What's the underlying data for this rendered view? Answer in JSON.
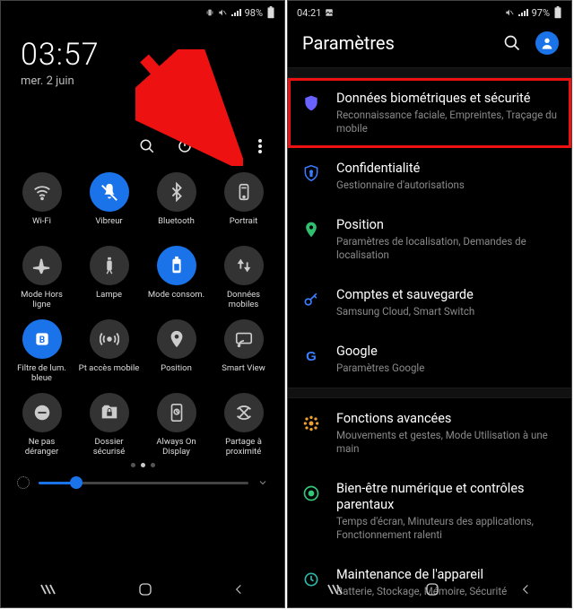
{
  "left": {
    "status": {
      "battery_text": "98%"
    },
    "clock": "03:57",
    "date": "mer. 2 juin",
    "qs": [
      {
        "name": "wifi",
        "label": "Wi-Fi",
        "on": false
      },
      {
        "name": "vibreur",
        "label": "Vibreur",
        "on": true
      },
      {
        "name": "bluetooth",
        "label": "Bluetooth",
        "on": false
      },
      {
        "name": "portrait",
        "label": "Portrait",
        "on": false
      },
      {
        "name": "mode-hors-ligne",
        "label": "Mode Hors ligne",
        "on": false
      },
      {
        "name": "lampe",
        "label": "Lampe",
        "on": false
      },
      {
        "name": "mode-conso",
        "label": "Mode consom.",
        "on": true
      },
      {
        "name": "donnees-mobiles",
        "label": "Données mobiles",
        "on": false
      },
      {
        "name": "filtre-lum-bleue",
        "label": "Filtre de lum. bleue",
        "on": true
      },
      {
        "name": "pt-acces-mobile",
        "label": "Pt accès mobile",
        "on": false
      },
      {
        "name": "position",
        "label": "Position",
        "on": false
      },
      {
        "name": "smart-view",
        "label": "Smart View",
        "on": false
      },
      {
        "name": "ne-pas-deranger",
        "label": "Ne pas déranger",
        "on": false
      },
      {
        "name": "dossier-securise",
        "label": "Dossier sécurisé",
        "on": false
      },
      {
        "name": "always-on-display",
        "label": "Always On Display",
        "on": false
      },
      {
        "name": "partage-proximite",
        "label": "Partage à proximité",
        "on": false
      }
    ],
    "brightness_pct": 18
  },
  "right": {
    "status": {
      "time": "04:21",
      "battery_text": "97%"
    },
    "title": "Paramètres",
    "sections": [
      [
        {
          "name": "biometrie",
          "title": "Données biométriques et sécurité",
          "sub": "Reconnaissance faciale, Empreintes, Traçage du mobile",
          "highlight": true,
          "icon": "shield-filled",
          "color": "#6a62ff"
        },
        {
          "name": "confidentialite",
          "title": "Confidentialité",
          "sub": "Gestionnaire d'autorisations",
          "icon": "shield-outline",
          "color": "#3b7dff"
        },
        {
          "name": "position",
          "title": "Position",
          "sub": "Paramètres de localisation, Demandes de localisation",
          "icon": "location",
          "color": "#2fbf6f"
        },
        {
          "name": "comptes",
          "title": "Comptes et sauvegarde",
          "sub": "Samsung Cloud, Smart Switch",
          "icon": "key",
          "color": "#3b7dff"
        },
        {
          "name": "google",
          "title": "Google",
          "sub": "Paramètres Google",
          "icon": "google",
          "color": "#3b7dff"
        }
      ],
      [
        {
          "name": "fonctions-avancees",
          "title": "Fonctions avancées",
          "sub": "Mouvements et gestes, Mode Utilisation à une main",
          "icon": "advanced",
          "color": "#f0a030"
        },
        {
          "name": "bien-etre",
          "title": "Bien-être numérique et contrôles parentaux",
          "sub": "Temps d'écran, Minuteurs des applications, Fonctionnement ralenti",
          "icon": "wellbeing",
          "color": "#34c77c"
        },
        {
          "name": "maintenance",
          "title": "Maintenance de l'appareil",
          "sub": "Batterie, Stockage, Mémoire, Sécurité",
          "icon": "maintenance",
          "color": "#2fb8a8"
        }
      ]
    ]
  }
}
